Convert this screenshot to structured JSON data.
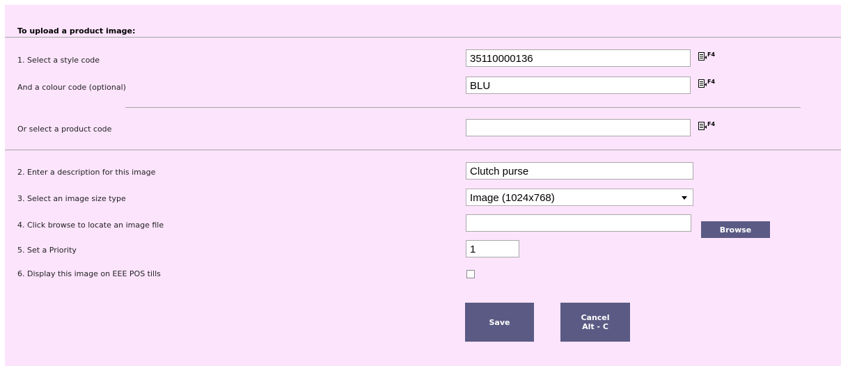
{
  "form": {
    "title": "To upload a product image:",
    "style_code_label": "1. Select a style code",
    "style_code_value": "35110000136",
    "colour_code_label": "And a colour code (optional)",
    "colour_code_value": "BLU",
    "product_code_label": "Or select a product code",
    "product_code_value": "",
    "description_label": "2. Enter a description for this image",
    "description_value": "Clutch purse",
    "size_type_label": "3. Select an image size type",
    "size_type_value": "Image (1024x768)",
    "file_label": "4. Click browse to locate an image file",
    "file_value": "",
    "browse_label": "Browse",
    "priority_label": "5. Set a Priority",
    "priority_value": "1",
    "pos_label": "6. Display this image on EEE POS tills",
    "pos_checked": false,
    "lookup_key": "F4",
    "save_label": "Save",
    "cancel_label": "Cancel",
    "cancel_shortcut": "Alt - C"
  },
  "colors": {
    "panel_background": "#fce4fc",
    "button_background": "#5b5a84",
    "button_text": "#ffffff"
  },
  "icons": {
    "lookup": "lookup-list-icon"
  }
}
